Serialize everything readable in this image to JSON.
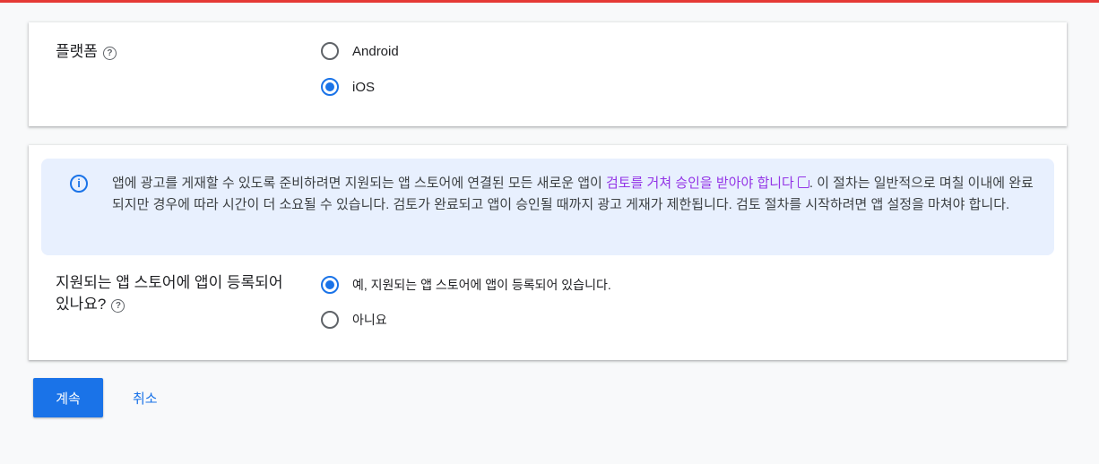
{
  "platform": {
    "label": "플랫폼",
    "help_icon": "help-circle-icon",
    "options": [
      "Android",
      "iOS"
    ],
    "selected": "iOS"
  },
  "notice": {
    "icon": "info-icon",
    "text_before": "앱에 광고를 게재할 수 있도록 준비하려면 지원되는 앱 스토어에 연결된 모든 새로운 앱이 ",
    "link_text": "검토를 거쳐 승인을 받아야 합니다",
    "text_after": ". 이 절차는 일반적으로 며칠 이내에 완료되지만 경우에 따라 시간이 더 소요될 수 있습니다. 검토가 완료되고 앱이 승인될 때까지 광고 게재가 제한됩니다. 검토 절차를 시작하려면 앱 설정을 마쳐야 합니다."
  },
  "listed": {
    "label": "지원되는 앱 스토어에 앱이 등록되어 있나요?",
    "help_icon": "help-circle-icon",
    "options": [
      "예, 지원되는 앱 스토어에 앱이 등록되어 있습니다.",
      "아니요"
    ],
    "selected": "예, 지원되는 앱 스토어에 앱이 등록되어 있습니다."
  },
  "actions": {
    "continue_label": "계속",
    "cancel_label": "취소"
  },
  "colors": {
    "accent": "#1a73e8",
    "link": "#9334e6",
    "top_bar": "#e53935",
    "notice_bg": "#e8f0fe"
  }
}
